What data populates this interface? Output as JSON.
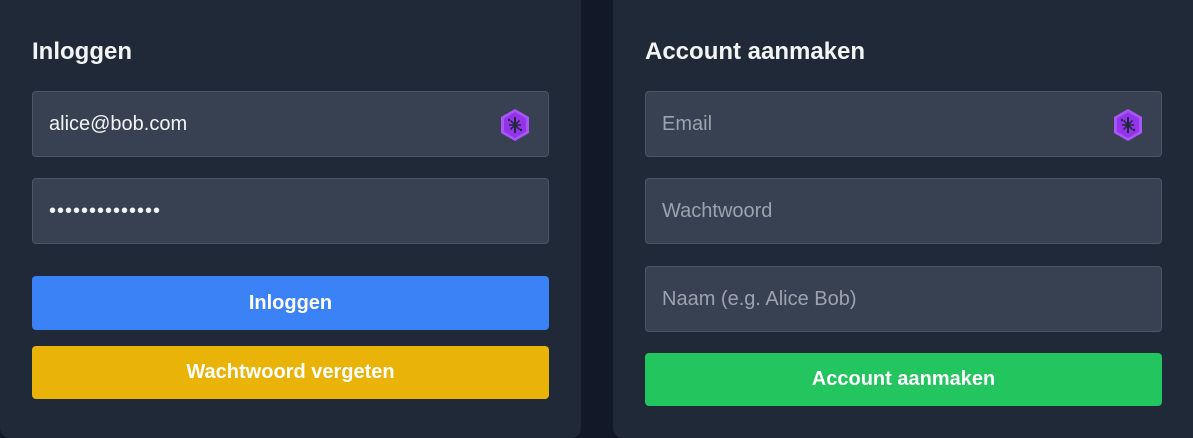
{
  "login": {
    "title": "Inloggen",
    "email_value": "alice@bob.com",
    "password_value": "••••••••••••••",
    "login_label": "Inloggen",
    "forgot_label": "Wachtwoord vergeten"
  },
  "signup": {
    "title": "Account aanmaken",
    "email_placeholder": "Email",
    "password_placeholder": "Wachtwoord",
    "name_placeholder": "Naam (e.g. Alice Bob)",
    "submit_label": "Account aanmaken"
  },
  "icons": {
    "password_manager": "password-manager-extension-icon"
  },
  "colors": {
    "primary": "#3b82f6",
    "warning": "#eab308",
    "success": "#22c55e",
    "extension": "#a855f7"
  }
}
